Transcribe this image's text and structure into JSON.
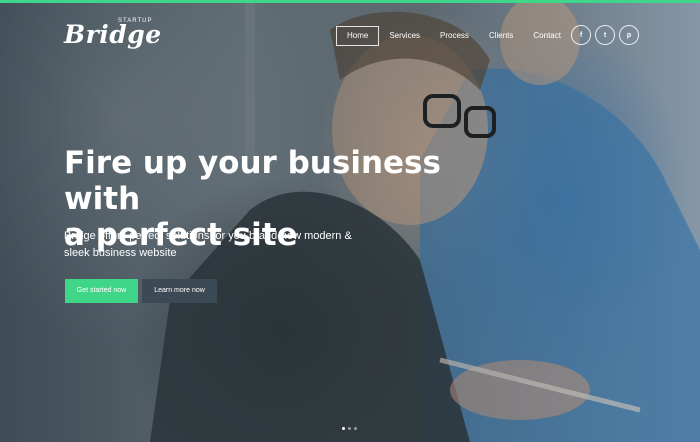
{
  "brand": {
    "name": "Bridge",
    "tagline": "STARTUP"
  },
  "nav": {
    "items": [
      {
        "label": "Home",
        "active": true
      },
      {
        "label": "Services",
        "active": false
      },
      {
        "label": "Process",
        "active": false
      },
      {
        "label": "Clients",
        "active": false
      },
      {
        "label": "Contact",
        "active": false
      }
    ]
  },
  "social": [
    {
      "icon": "facebook-icon",
      "glyph": "f"
    },
    {
      "icon": "twitter-icon",
      "glyph": "t"
    },
    {
      "icon": "pinterest-icon",
      "glyph": "p"
    }
  ],
  "hero": {
    "headline_line1": "Fire up your business with",
    "headline_line2": "a perfect site",
    "subtitle": "Bridge offers perfect solutions for you brand-new modern & sleek business website",
    "primary_button": "Get started now",
    "secondary_button": "Learn more now",
    "slides": 3,
    "active_slide": 1
  },
  "colors": {
    "accent": "#3fd68a",
    "secondary_button": "#3c4a55",
    "text": "#ffffff"
  }
}
